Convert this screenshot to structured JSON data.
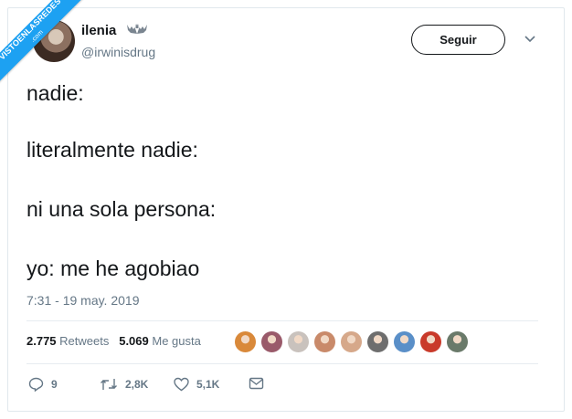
{
  "watermark": {
    "text": "VISTOENLASREDES",
    "sub": ".com",
    "color": "#1da1f2"
  },
  "user": {
    "name": "ilenia",
    "handle": "@irwinisdrug",
    "badge_icon": "bat-icon"
  },
  "follow_button": "Seguir",
  "menu_icon": "chevron-down-icon",
  "tweet": {
    "lines": [
      "nadie:",
      "literalmente nadie:",
      "ni una sola persona:",
      "yo: me he agobiao"
    ],
    "timestamp": "7:31 - 19 may. 2019"
  },
  "stats": {
    "retweets_count": "2.775",
    "retweets_label": "Retweets",
    "likes_count": "5.069",
    "likes_label": "Me gusta"
  },
  "liker_avatars": [
    {
      "color": "#d9893a"
    },
    {
      "color": "#9a5a6a"
    },
    {
      "color": "#c9c2bd"
    },
    {
      "color": "#c98a6a"
    },
    {
      "color": "#d6a88a"
    },
    {
      "color": "#6e6e6e"
    },
    {
      "color": "#5a8fc8"
    },
    {
      "color": "#c93a2a"
    },
    {
      "color": "#6a7a6a"
    }
  ],
  "actions": {
    "reply_count": "9",
    "retweet_count": "2,8K",
    "like_count": "5,1K"
  },
  "colors": {
    "text": "#14171a",
    "secondary": "#657786",
    "border": "#e6ecf0"
  }
}
